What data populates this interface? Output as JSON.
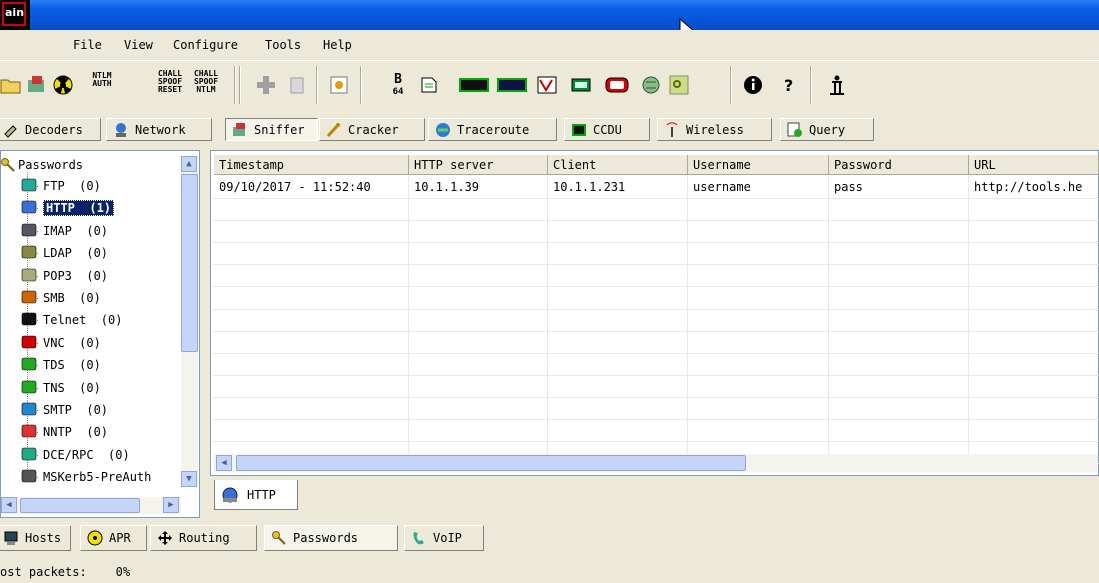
{
  "app": {
    "icon_text": "ain"
  },
  "menu": [
    {
      "label": "File"
    },
    {
      "label": "View"
    },
    {
      "label": "Configure"
    },
    {
      "label": "Tools"
    },
    {
      "label": "Help"
    }
  ],
  "toolbar": {
    "ntlm_auth": [
      "NTLM",
      "AUTH"
    ],
    "chall_spoof_reset": [
      "CHALL",
      "SPOOF",
      "RESET"
    ],
    "chall_spoof_ntlm": [
      "CHALL",
      "SPOOF",
      "NTLM"
    ],
    "base64": [
      "B",
      "64"
    ]
  },
  "tabs": [
    {
      "label": "Decoders",
      "icon": "decoder-icon"
    },
    {
      "label": "Network",
      "icon": "network-icon"
    },
    {
      "label": "Sniffer",
      "icon": "sniffer-icon",
      "active": true
    },
    {
      "label": "Cracker",
      "icon": "cracker-icon"
    },
    {
      "label": "Traceroute",
      "icon": "traceroute-icon"
    },
    {
      "label": "CCDU",
      "icon": "ccdu-icon"
    },
    {
      "label": "Wireless",
      "icon": "wireless-icon"
    },
    {
      "label": "Query",
      "icon": "query-icon"
    }
  ],
  "tree": {
    "root": "Passwords",
    "items": [
      {
        "label": "FTP  (0)"
      },
      {
        "label": "HTTP  (1)",
        "selected": true
      },
      {
        "label": "IMAP  (0)"
      },
      {
        "label": "LDAP  (0)"
      },
      {
        "label": "POP3  (0)"
      },
      {
        "label": "SMB  (0)"
      },
      {
        "label": "Telnet  (0)"
      },
      {
        "label": "VNC  (0)"
      },
      {
        "label": "TDS  (0)"
      },
      {
        "label": "TNS  (0)"
      },
      {
        "label": "SMTP  (0)"
      },
      {
        "label": "NNTP  (0)"
      },
      {
        "label": "DCE/RPC  (0)"
      },
      {
        "label": "MSKerb5-PreAuth"
      }
    ]
  },
  "table": {
    "columns": [
      "Timestamp",
      "HTTP server",
      "Client",
      "Username",
      "Password",
      "URL"
    ],
    "rows": [
      [
        "09/10/2017 - 11:52:40",
        "10.1.1.39",
        "10.1.1.231",
        "username",
        "pass",
        "http://tools.he"
      ]
    ]
  },
  "subtab": {
    "label": "HTTP"
  },
  "bottom_tabs": [
    {
      "label": "Hosts"
    },
    {
      "label": "APR"
    },
    {
      "label": "Routing"
    },
    {
      "label": "Passwords",
      "active": true
    },
    {
      "label": "VoIP"
    }
  ],
  "status": {
    "text": "ost packets:    0%"
  }
}
